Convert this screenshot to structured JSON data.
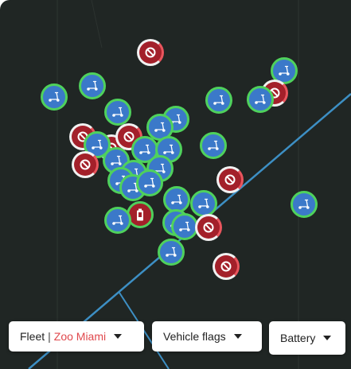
{
  "map": {
    "colors": {
      "background": "#202624",
      "road": "#3d8fc4",
      "scooter_fill": "#3b79c9",
      "scooter_ring": "#4fd15c",
      "blocked_fill": "#a3202a"
    },
    "scooter_icon": "scooter-icon",
    "blocked_icon": "no-entry-icon",
    "battery_icon": "low-battery-icon",
    "markers": [
      {
        "kind": "blocked"
      },
      {
        "kind": "scooter"
      },
      {
        "kind": "scooter"
      },
      {
        "kind": "scooter"
      },
      {
        "kind": "scooter"
      },
      {
        "kind": "blocked"
      },
      {
        "kind": "scooter"
      },
      {
        "kind": "scooter"
      },
      {
        "kind": "scooter"
      },
      {
        "kind": "scooter"
      },
      {
        "kind": "blocked"
      },
      {
        "kind": "scooter"
      },
      {
        "kind": "blocked"
      },
      {
        "kind": "blocked"
      },
      {
        "kind": "scooter"
      },
      {
        "kind": "scooter"
      },
      {
        "kind": "scooter"
      },
      {
        "kind": "blocked"
      },
      {
        "kind": "scooter"
      },
      {
        "kind": "scooter"
      },
      {
        "kind": "scooter"
      },
      {
        "kind": "scooter"
      },
      {
        "kind": "blocked"
      },
      {
        "kind": "scooter"
      },
      {
        "kind": "scooter"
      },
      {
        "kind": "battery"
      },
      {
        "kind": "scooter"
      },
      {
        "kind": "scooter"
      },
      {
        "kind": "scooter"
      },
      {
        "kind": "scooter"
      },
      {
        "kind": "scooter"
      },
      {
        "kind": "blocked"
      },
      {
        "kind": "scooter"
      },
      {
        "kind": "scooter"
      },
      {
        "kind": "blocked"
      }
    ]
  },
  "toolbar": {
    "fleet_label": "Fleet",
    "fleet_separator": "|",
    "fleet_value": "Zoo Miami",
    "vehicle_flags_label": "Vehicle flags",
    "battery_label": "Battery",
    "dropdown_icon": "caret-down-icon"
  }
}
